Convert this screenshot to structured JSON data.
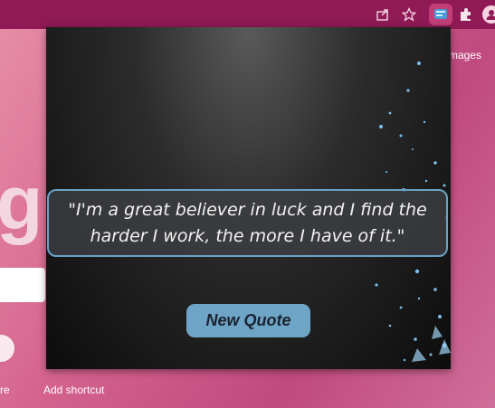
{
  "background": {
    "images_link": "mages",
    "logo_fragment": "g",
    "shortcut_label_left": "re",
    "add_shortcut_label": "Add shortcut"
  },
  "toolbar": {
    "icons": [
      "share-icon",
      "star-icon",
      "extension-quote-icon",
      "puzzle-icon",
      "profile-icon"
    ]
  },
  "popup": {
    "quote": "\"I'm a great believer in luck and I find the harder I work, the more I have of it.\"",
    "button_label": "New Quote"
  },
  "colors": {
    "toolbar": "#8f1a55",
    "accent": "#6ea5c6",
    "quote_border": "#6aa2c4"
  }
}
